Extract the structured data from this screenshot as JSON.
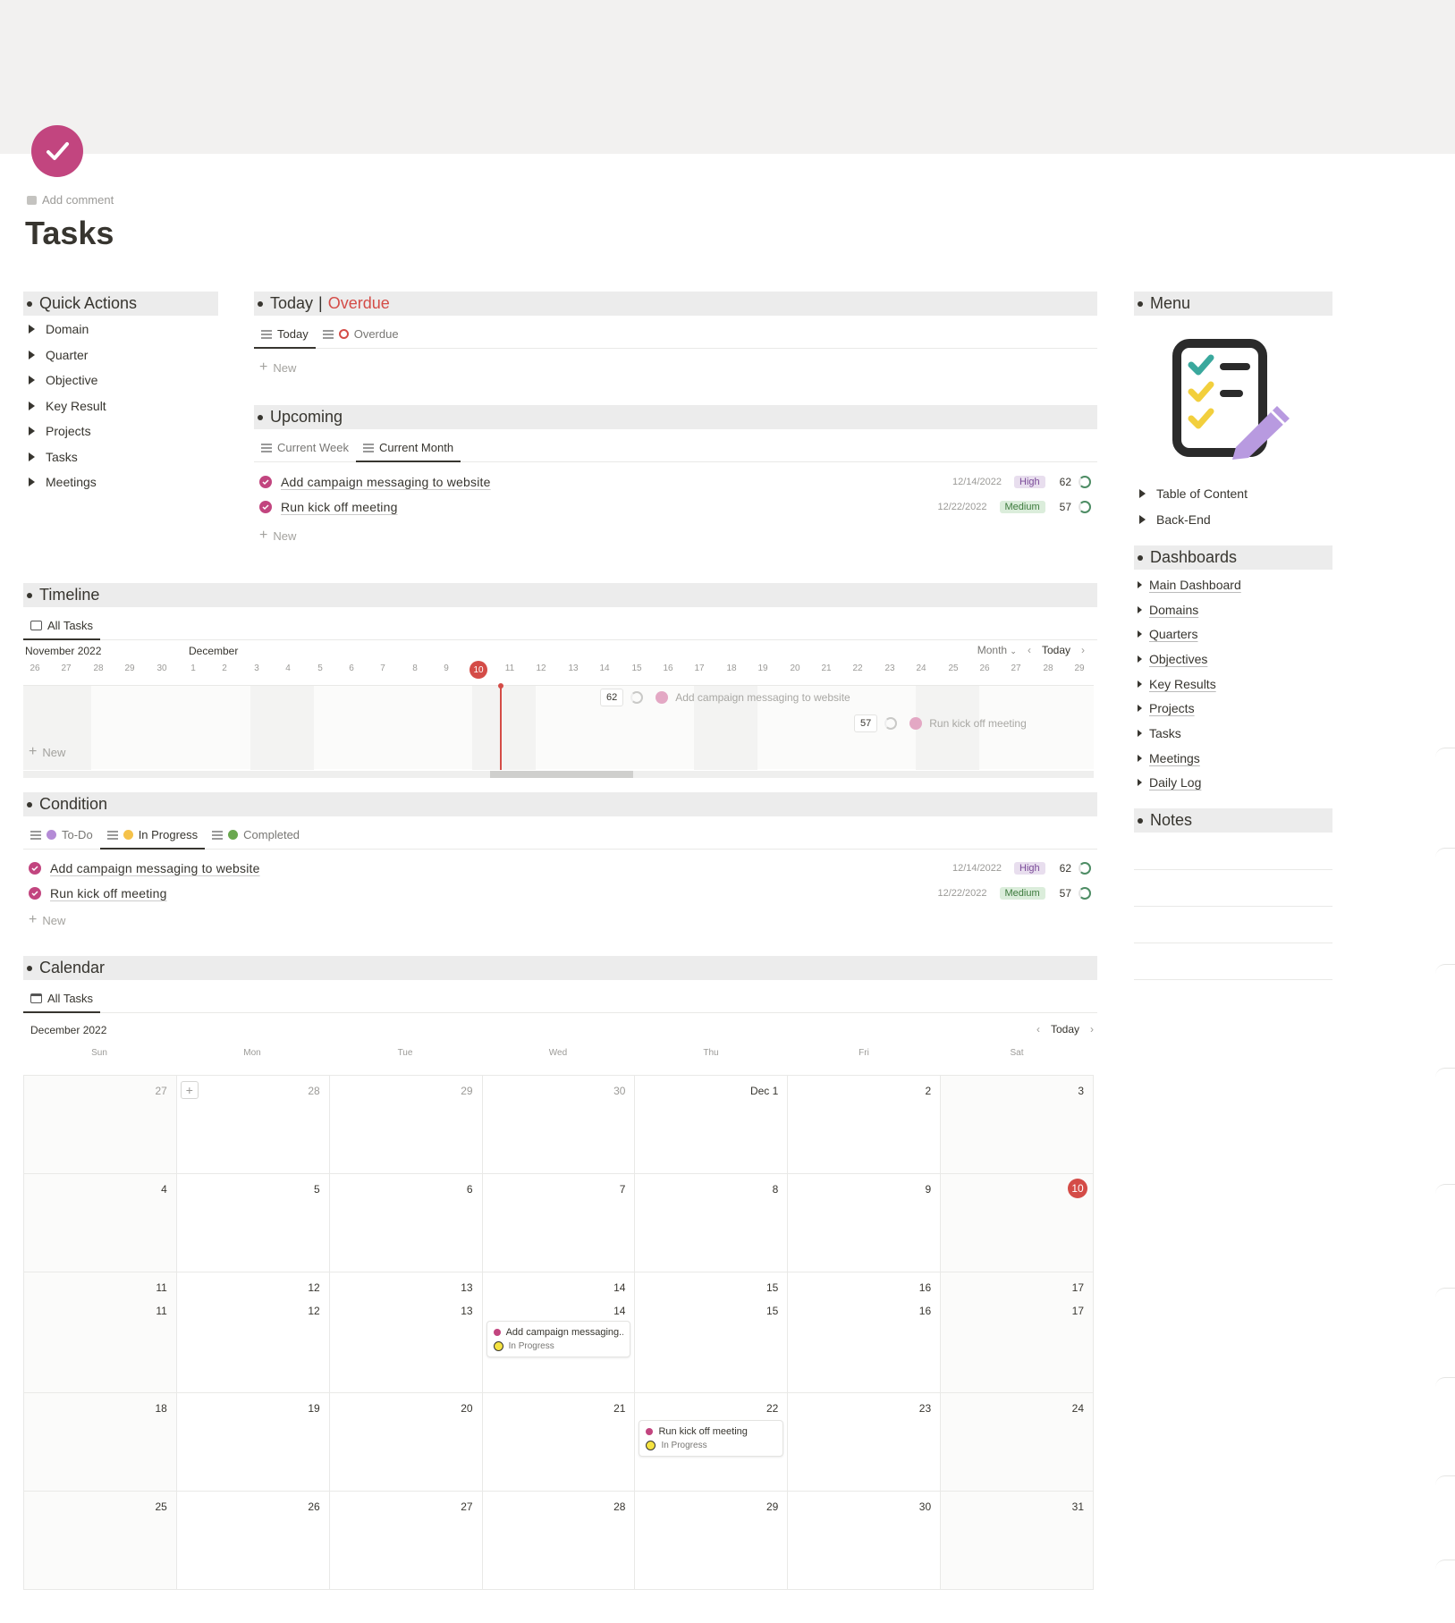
{
  "page": {
    "title": "Tasks",
    "add_comment": "Add comment"
  },
  "colors": {
    "accent": "#c2457f",
    "red": "#d44c47",
    "section_bg": "#ececec",
    "cover": "#f2f1f0"
  },
  "quick_actions": {
    "title": "Quick Actions",
    "items": [
      "Domain",
      "Quarter",
      "Objective",
      "Key Result",
      "Projects",
      "Tasks",
      "Meetings"
    ]
  },
  "today": {
    "title": "Today",
    "sep": "|",
    "overdue_title": "Overdue",
    "tabs": [
      "Today",
      "Overdue"
    ],
    "new_label": "New"
  },
  "upcoming": {
    "title": "Upcoming",
    "tabs": [
      "Current Week",
      "Current Month"
    ],
    "new_label": "New"
  },
  "tasks": [
    {
      "name": "Add campaign messaging to website",
      "date": "12/14/2022",
      "priority": "High",
      "score": "62",
      "status": "In Progress",
      "short": "Add campaign messaging..."
    },
    {
      "name": "Run kick off meeting",
      "date": "12/22/2022",
      "priority": "Medium",
      "score": "57",
      "status": "In Progress",
      "short": "Run kick off meeting"
    }
  ],
  "timeline": {
    "title": "Timeline",
    "tab": "All Tasks",
    "month_nov": "November 2022",
    "month_dec": "December",
    "view": "Month",
    "today_label": "Today",
    "new_label": "New",
    "days": [
      "26",
      "27",
      "28",
      "29",
      "30",
      "1",
      "2",
      "3",
      "4",
      "5",
      "6",
      "7",
      "8",
      "9",
      "10",
      "11",
      "12",
      "13",
      "14",
      "15",
      "16",
      "17",
      "18",
      "19",
      "20",
      "21",
      "22",
      "23",
      "24",
      "25",
      "26",
      "27",
      "28",
      "29"
    ],
    "today_day": "10"
  },
  "condition": {
    "title": "Condition",
    "tabs": [
      "To-Do",
      "In Progress",
      "Completed"
    ],
    "tab_colors": [
      "#b48bd6",
      "#f5c24a",
      "#6aa84f"
    ],
    "new_label": "New"
  },
  "calendar": {
    "title": "Calendar",
    "tab": "All Tasks",
    "month": "December 2022",
    "today_label": "Today",
    "dow": [
      "Sun",
      "Mon",
      "Tue",
      "Wed",
      "Thu",
      "Fri",
      "Sat"
    ],
    "weeks": [
      [
        "27",
        "28",
        "29",
        "30",
        "Dec 1",
        "2",
        "3"
      ],
      [
        "4",
        "5",
        "6",
        "7",
        "8",
        "9",
        "10"
      ],
      [
        "11",
        "12",
        "13",
        "14",
        "15",
        "16",
        "17"
      ],
      [
        "18",
        "19",
        "20",
        "21",
        "22",
        "23",
        "24"
      ],
      [
        "25",
        "26",
        "27",
        "28",
        "29",
        "30",
        "31"
      ]
    ]
  },
  "menu": {
    "title": "Menu",
    "items": [
      "Table of Content",
      "Back-End"
    ]
  },
  "dashboards": {
    "title": "Dashboards",
    "items": [
      "Main Dashboard",
      "Domains",
      "Quarters",
      "Objectives",
      "Key Results",
      "Projects",
      "Tasks",
      "Meetings",
      "Daily Log"
    ]
  },
  "notes": {
    "title": "Notes"
  }
}
